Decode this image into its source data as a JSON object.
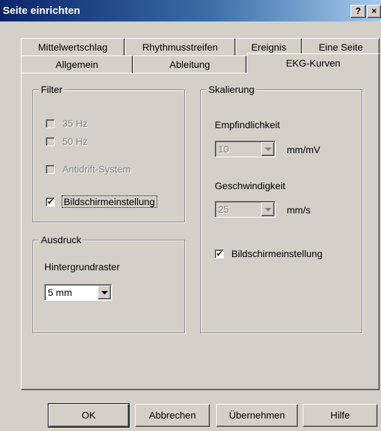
{
  "window": {
    "title": "Seite einrichten",
    "help_label": "?",
    "close_label": "×"
  },
  "tabs": {
    "row1": [
      "Mittelwertschlag",
      "Rhythmusstreifen",
      "Ereignis",
      "Eine Seite"
    ],
    "row2": [
      "Allgemein",
      "Ableitung",
      "EKG-Kurven"
    ],
    "active": "EKG-Kurven"
  },
  "filter": {
    "title": "Filter",
    "options": [
      {
        "label": "35 Hz",
        "checked": false,
        "enabled": false
      },
      {
        "label": "50 Hz",
        "checked": false,
        "enabled": false
      },
      {
        "label": "Antidrift-System",
        "checked": false,
        "enabled": false
      },
      {
        "label": "Bildschirmeinstellung",
        "checked": true,
        "enabled": true
      }
    ]
  },
  "ausdruck": {
    "title": "Ausdruck",
    "grid_label": "Hintergrundraster",
    "grid_value": "5 mm"
  },
  "skalierung": {
    "title": "Skalierung",
    "sensitivity_label": "Empfindlichkeit",
    "sensitivity_value": "10",
    "sensitivity_unit": "mm/mV",
    "speed_label": "Geschwindigkeit",
    "speed_value": "25",
    "speed_unit": "mm/s",
    "screen_setting": {
      "label": "Bildschirmeinstellung",
      "checked": true,
      "enabled": true
    }
  },
  "buttons": {
    "ok": "OK",
    "cancel": "Abbrechen",
    "apply": "Übernehmen",
    "help": "Hilfe"
  }
}
